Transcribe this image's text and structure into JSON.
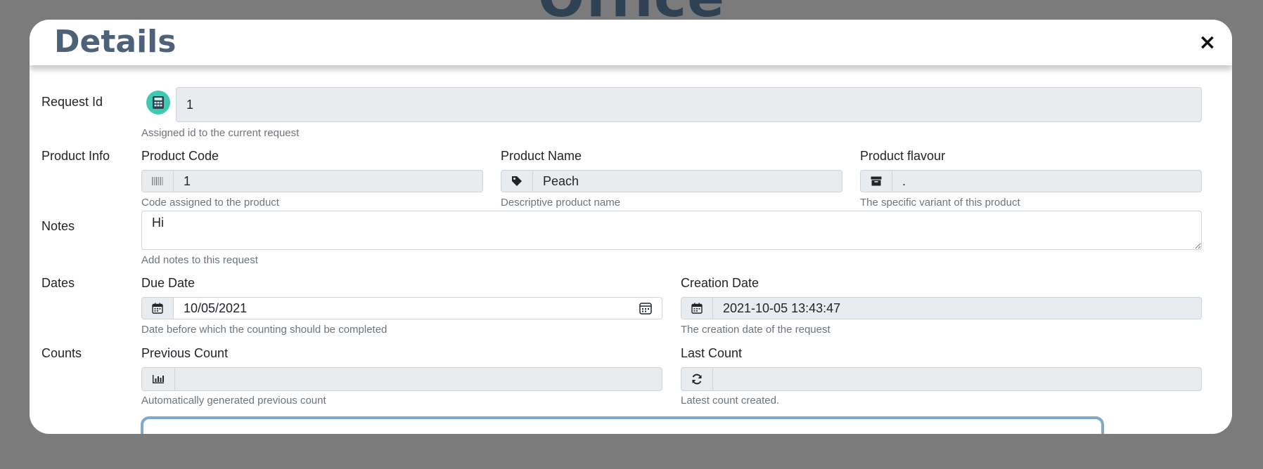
{
  "background": {
    "title": "Office"
  },
  "modal": {
    "title": "Details",
    "close_label": "×"
  },
  "request_id": {
    "label": "Request Id",
    "value": "1",
    "help": "Assigned id to the current request",
    "icon": "calculator-icon"
  },
  "product_info": {
    "label": "Product Info",
    "code": {
      "label": "Product Code",
      "value": "1",
      "help": "Code assigned to the product",
      "icon": "barcode-icon"
    },
    "name": {
      "label": "Product Name",
      "value": "Peach",
      "help": "Descriptive product name",
      "icon": "tag-icon"
    },
    "flavour": {
      "label": "Product flavour",
      "value": ".",
      "help": "The specific variant of this product",
      "icon": "archive-icon"
    }
  },
  "notes": {
    "label": "Notes",
    "value": "Hi",
    "help": "Add notes to this request"
  },
  "dates": {
    "label": "Dates",
    "due": {
      "label": "Due Date",
      "value": "10/05/2021",
      "help": "Date before which the counting should be completed",
      "icon": "calendar-icon"
    },
    "creation": {
      "label": "Creation Date",
      "value": "2021-10-05 13:43:47",
      "help": "The creation date of the request",
      "icon": "calendar-icon"
    }
  },
  "counts": {
    "label": "Counts",
    "previous": {
      "label": "Previous Count",
      "value": "",
      "help": "Automatically generated previous count",
      "icon": "bar-chart-icon"
    },
    "last": {
      "label": "Last Count",
      "value": "",
      "help": "Latest count created.",
      "icon": "refresh-icon"
    }
  },
  "colors": {
    "overlay": "#7b7b7b",
    "title": "#4d6278",
    "readonly_bg": "#e9ecef",
    "icon_accent": "#3fc9b0",
    "panel_border": "#7fa8c9"
  }
}
